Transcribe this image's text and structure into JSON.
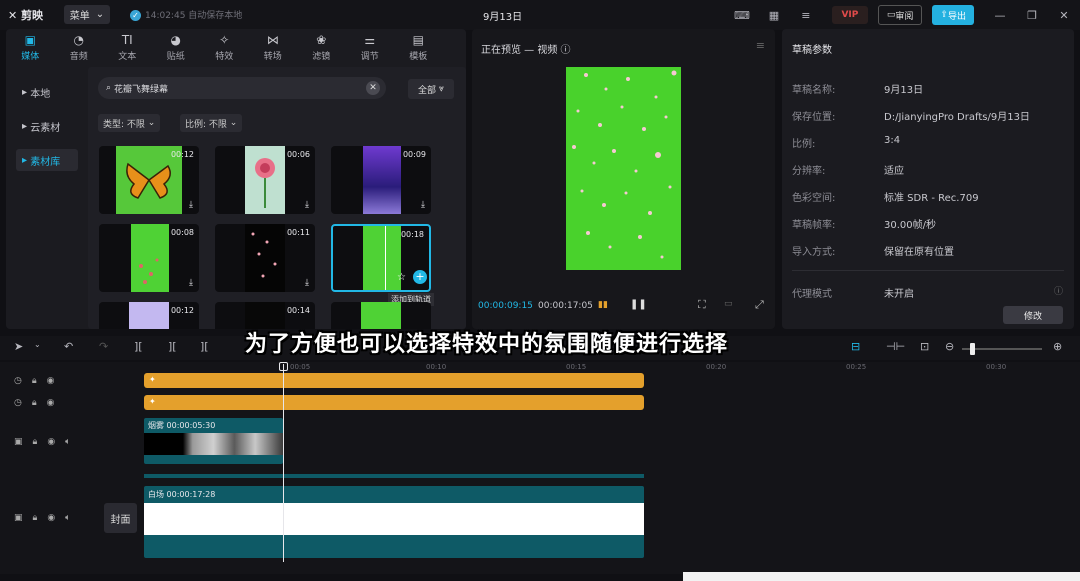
{
  "topbar": {
    "logo": "剪映",
    "menu_label": "菜单",
    "autosave": "14:02:45 自动保存本地",
    "project_title": "9月13日",
    "vip": "VIP",
    "review": "审阅",
    "export": "导出"
  },
  "media_tabs": [
    {
      "label": "媒体",
      "icon": "media-icon"
    },
    {
      "label": "音频",
      "icon": "audio-icon"
    },
    {
      "label": "文本",
      "icon": "text-icon"
    },
    {
      "label": "贴纸",
      "icon": "sticker-icon"
    },
    {
      "label": "特效",
      "icon": "effects-icon"
    },
    {
      "label": "转场",
      "icon": "transition-icon"
    },
    {
      "label": "滤镜",
      "icon": "filter-icon"
    },
    {
      "label": "调节",
      "icon": "adjust-icon"
    },
    {
      "label": "模板",
      "icon": "template-icon"
    }
  ],
  "sidebar": {
    "items": [
      "本地",
      "云素材",
      "素材库"
    ]
  },
  "library": {
    "search_value": "花瓣飞舞绿幕",
    "all_label": "全部",
    "filter_type": "类型: 不限",
    "filter_ratio": "比例: 不限",
    "tooltip": "添加到轨道",
    "thumbs": [
      {
        "duration": "00:12",
        "icon": "butterfly"
      },
      {
        "duration": "00:06",
        "icon": "rose"
      },
      {
        "duration": "00:09",
        "icon": "purple-light"
      },
      {
        "duration": "00:08",
        "icon": "green-petals"
      },
      {
        "duration": "00:11",
        "icon": "black-petals"
      },
      {
        "duration": "00:18",
        "icon": "green-split"
      },
      {
        "duration": "00:12",
        "icon": "purple-frame"
      },
      {
        "duration": "00:14",
        "icon": "petals"
      },
      {
        "duration": "",
        "icon": "green"
      }
    ]
  },
  "preview": {
    "title": "正在预览 — 视频",
    "time_current": "00:00:09:15",
    "time_total": "00:00:17:05"
  },
  "params": {
    "title": "草稿参数",
    "rows": [
      {
        "k": "草稿名称:",
        "v": "9月13日"
      },
      {
        "k": "保存位置:",
        "v": "D:/JianyingPro Drafts/9月13日"
      },
      {
        "k": "比例:",
        "v": "3:4"
      },
      {
        "k": "分辨率:",
        "v": "适应"
      },
      {
        "k": "色彩空间:",
        "v": "标准 SDR - Rec.709"
      },
      {
        "k": "草稿帧率:",
        "v": "30.00帧/秒"
      },
      {
        "k": "导入方式:",
        "v": "保留在原有位置"
      },
      {
        "k": "代理模式",
        "v": "未开启"
      }
    ],
    "edit_label": "修改"
  },
  "subtitle": "为了方便也可以选择特效中的氛围随便进行选择",
  "timeline": {
    "ruler": [
      "00:05",
      "00:10",
      "00:15",
      "00:20",
      "00:25",
      "00:30"
    ],
    "smoke_label": "烟雾  00:00:05:30",
    "main_label": "白场  00:00:17:28",
    "cover_label": "封面"
  },
  "colors": {
    "accent": "#22b8e6",
    "effect_bar": "#e4a02c",
    "clip": "#0e5a66",
    "green_screen": "#49d22c"
  }
}
